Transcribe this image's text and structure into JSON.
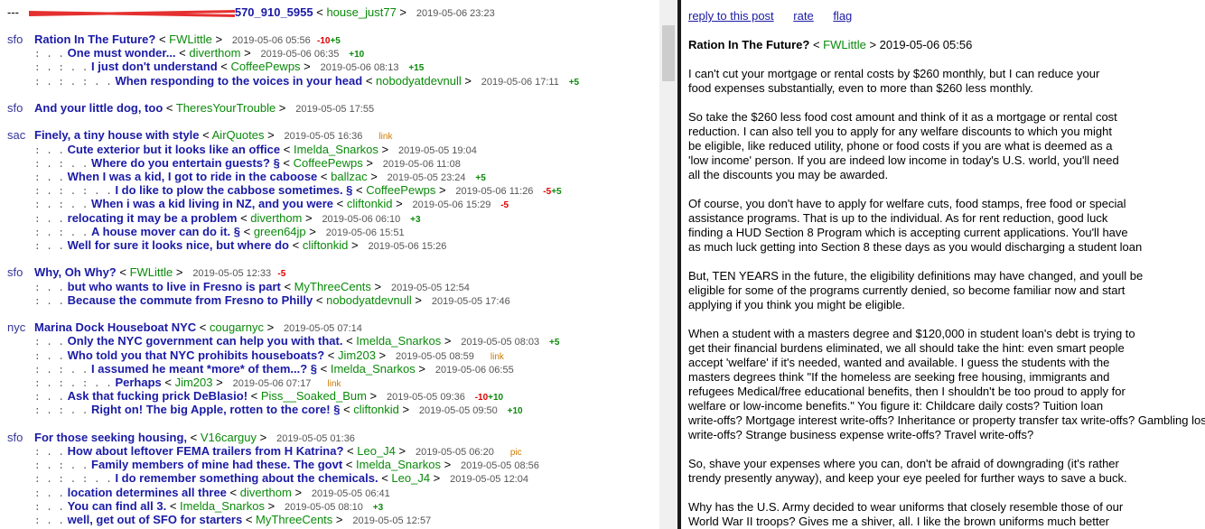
{
  "top": {
    "dashes": "---",
    "suffix": "570_910_5955",
    "author": "house_just77",
    "date": "2019-05-06 23:23"
  },
  "threads": [
    {
      "cat": "sfo",
      "title": "Ration In The Future?",
      "author": "FWLittle",
      "date": "2019-05-06 05:56",
      "score": "-10",
      "score2": "+5",
      "replies": [
        {
          "d": ": . .",
          "title": "One must wonder...",
          "author": "diverthom",
          "date": "2019-05-06 06:35",
          "score": "+10"
        },
        {
          "d": ": . : . .",
          "title": "I just don't understand",
          "author": "CoffeePewps",
          "date": "2019-05-06 08:13",
          "score": "+15"
        },
        {
          "d": ": . : . : . .",
          "title": "When responding to the voices in your head",
          "author": "nobodyatdevnull",
          "date": "2019-05-06 17:11",
          "score": "+5"
        }
      ]
    },
    {
      "cat": "sfo",
      "title": "And your little dog, too",
      "author": "TheresYourTrouble",
      "date": "2019-05-05 17:55",
      "replies": []
    },
    {
      "cat": "sac",
      "title": "Finely, a tiny house with style",
      "author": "AirQuotes",
      "date": "2019-05-05 16:36",
      "tag": "link",
      "replies": [
        {
          "d": ": . .",
          "title": "Cute exterior but it looks like an office",
          "author": "Imelda_Snarkos",
          "date": "2019-05-05 19:04"
        },
        {
          "d": ": . : . .",
          "title": "Where do you entertain guests? §",
          "author": "CoffeePewps",
          "date": "2019-05-06 11:08"
        },
        {
          "d": ": . .",
          "title": "When I was a kid, I got to ride in the caboose",
          "author": "ballzac",
          "date": "2019-05-05 23:24",
          "score": "+5"
        },
        {
          "d": ": . : . : . .",
          "title": "I do like to plow the cabbose sometimes. §",
          "author": "CoffeePewps",
          "date": "2019-05-06 11:26",
          "score": "-5",
          "score2": "+5"
        },
        {
          "d": ": . : . .",
          "title": "When i was a kid living in NZ, and you were",
          "author": "cliftonkid",
          "date": "2019-05-06 15:29",
          "score": "-5"
        },
        {
          "d": ": . .",
          "title": "relocating it may be a problem",
          "author": "diverthom",
          "date": "2019-05-06 06:10",
          "score": "+3"
        },
        {
          "d": ": . : . .",
          "title": "A house mover can do it. §",
          "author": "green64jp",
          "date": "2019-05-06 15:51"
        },
        {
          "d": ": . .",
          "title": "Well for sure it looks nice, but where do",
          "author": "cliftonkid",
          "date": "2019-05-06 15:26"
        }
      ]
    },
    {
      "cat": "sfo",
      "title": "Why, Oh Why?",
      "author": "FWLittle",
      "date": "2019-05-05 12:33",
      "score": "-5",
      "replies": [
        {
          "d": ": . .",
          "title": "but who wants to live in Fresno is part",
          "author": "MyThreeCents",
          "date": "2019-05-05 12:54"
        },
        {
          "d": ": . .",
          "title": "Because the commute from Fresno to Philly",
          "author": "nobodyatdevnull",
          "date": "2019-05-05 17:46"
        }
      ]
    },
    {
      "cat": "nyc",
      "title": "Marina Dock Houseboat NYC",
      "author": "cougarnyc",
      "date": "2019-05-05 07:14",
      "replies": [
        {
          "d": ": . .",
          "title": "Only the NYC government can help you with that.",
          "author": "Imelda_Snarkos",
          "date": "2019-05-05 08:03",
          "score": "+5"
        },
        {
          "d": ": . .",
          "title": "Who told you that NYC prohibits houseboats?",
          "author": "Jim203",
          "date": "2019-05-05 08:59",
          "tag": "link"
        },
        {
          "d": ": . : . .",
          "title": "I assumed he meant *more* of them...? §",
          "author": "Imelda_Snarkos",
          "date": "2019-05-06 06:55"
        },
        {
          "d": ": . : . : . .",
          "title": "Perhaps",
          "author": "Jim203",
          "date": "2019-05-06 07:17",
          "tag": "link"
        },
        {
          "d": ": . .",
          "title": "Ask that fucking prick DeBlasio!",
          "author": "Piss__Soaked_Bum",
          "date": "2019-05-05 09:36",
          "score": "-10",
          "score2": "+10"
        },
        {
          "d": ": . : . .",
          "title": "Right on! The big Apple, rotten to the core! §",
          "author": "cliftonkid",
          "date": "2019-05-05 09:50",
          "score": "+10"
        }
      ]
    },
    {
      "cat": "sfo",
      "title": "For those seeking housing,",
      "author": "V16carguy",
      "date": "2019-05-05 01:36",
      "replies": [
        {
          "d": ": . .",
          "title": "How about leftover FEMA trailers from H Katrina?",
          "author": "Leo_J4",
          "date": "2019-05-05 06:20",
          "tag": "pic"
        },
        {
          "d": ": . : . .",
          "title": "Family members of mine had these. The govt",
          "author": "Imelda_Snarkos",
          "date": "2019-05-05 08:56"
        },
        {
          "d": ": . : . : . .",
          "title": "I do remember something about the chemicals.",
          "author": "Leo_J4",
          "date": "2019-05-05 12:04"
        },
        {
          "d": ": . .",
          "title": "location determines all three",
          "author": "diverthom",
          "date": "2019-05-05 06:41"
        },
        {
          "d": ": . .",
          "title": "You can find all 3.",
          "author": "Imelda_Snarkos",
          "date": "2019-05-05 08:10",
          "score": "+3"
        },
        {
          "d": ": . .",
          "title": "well, get out of SFO for starters",
          "author": "MyThreeCents",
          "date": "2019-05-05 12:57"
        }
      ]
    }
  ],
  "right": {
    "links": [
      "reply to this post",
      "rate",
      "flag"
    ],
    "title": "Ration In The Future?",
    "author": "FWLittle",
    "date": "2019-05-06 05:56",
    "lines": [
      "I can't cut your mortgage or rental costs by $260 monthly, but I can reduce your",
      "food expenses substantially, even to more than $260 less monthly.",
      "",
      "So take the $260 less food cost amount and think of it as a mortgage or rental cost",
      "reduction. I can also tell you to apply for any welfare discounts to which you might",
      "be eligible, like reduced utility, phone or food costs if you are what is deemed as a",
      "'low income' person. If you are indeed low income in today's U.S. world, you'll need",
      "all the discounts you may be awarded.",
      "",
      "Of course, you don't have to apply for welfare cuts, food stamps, free food or special",
      "assistance programs. That is up to the individual. As for rent reduction, good luck",
      "finding a HUD Section 8 Program which is accepting current applications. You'll have",
      "as much luck getting into Section 8 these days as you would discharging a student loan",
      "",
      "But, TEN YEARS in the future, the eligibility definitions may have changed, and youll be",
      "eligible for some of the programs currently denied, so become familiar now and start",
      "applying if you think you might be eligible.",
      "",
      "When a student with a masters degree and $120,000 in student loan's debt is trying to",
      "get their financial burdens eliminated, we all should take the hint: even smart people",
      "accept 'welfare' if it's needed, wanted and available. I guess the students with the",
      "masters degrees think \"If the homeless are seeking free housing, immigrants and",
      "refugees Medical/free educational benefits, then I shouldn't be too proud to apply for",
      "welfare or low-income benefits.\" You figure it: Childcare daily costs? Tuition loan",
      "write-offs? Mortgage interest write-offs? Inheritance or property transfer tax write-offs? Gambling loss",
      "write-offs? Strange business expense write-offs? Travel write-offs?",
      "",
      "So, shave your expenses where you can, don't be afraid of downgrading (it's rather",
      "trendy presently anyway), and keep your eye peeled for further ways to save a buck.",
      "",
      "Why has the U.S. Army decided to wear uniforms that closely resemble those of our",
      "World War II troops? Gives me a shiver, all. I like the brown uniforms much better"
    ]
  }
}
